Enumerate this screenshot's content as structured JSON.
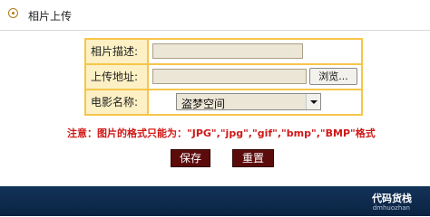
{
  "header": {
    "title": "相片上传",
    "icon": "circle-bullet-icon"
  },
  "form": {
    "description_label": "相片描述:",
    "description_value": "",
    "address_label": "上传地址:",
    "address_value": "",
    "browse_label": "浏览...",
    "movie_label": "电影名称:",
    "movie_selected": "盗梦空间"
  },
  "notice": "注意：图片的格式只能为：\"JPG\",\"jpg\",\"gif\",\"bmp\",\"BMP\"格式",
  "buttons": {
    "save": "保存",
    "reset": "重置"
  },
  "footer": {
    "watermark": "代码货栈",
    "watermark_sub": "dmhuozhan"
  },
  "colors": {
    "table_border": "#f6c54a",
    "label_bg": "#fdf0c4",
    "button_bg": "#5c0b0b",
    "notice": "#d01818",
    "footer": "#123358"
  }
}
